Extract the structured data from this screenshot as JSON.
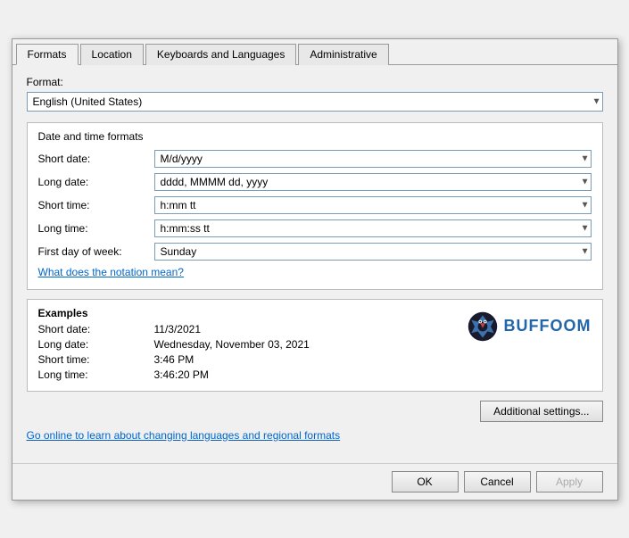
{
  "tabs": [
    {
      "label": "Formats",
      "active": true
    },
    {
      "label": "Location",
      "active": false
    },
    {
      "label": "Keyboards and Languages",
      "active": false
    },
    {
      "label": "Administrative",
      "active": false
    }
  ],
  "format_section": {
    "label": "Format:",
    "selected": "English (United States)"
  },
  "date_time_group": {
    "title": "Date and time formats",
    "rows": [
      {
        "label": "Short date:",
        "value": "M/d/yyyy"
      },
      {
        "label": "Long date:",
        "value": "dddd, MMMM dd, yyyy"
      },
      {
        "label": "Short time:",
        "value": "h:mm tt"
      },
      {
        "label": "Long time:",
        "value": "h:mm:ss tt"
      },
      {
        "label": "First day of week:",
        "value": "Sunday"
      }
    ]
  },
  "notation_link": "What does the notation mean?",
  "examples": {
    "title": "Examples",
    "rows": [
      {
        "label": "Short date:",
        "value": "11/3/2021"
      },
      {
        "label": "Long date:",
        "value": "Wednesday, November 03, 2021"
      },
      {
        "label": "Short time:",
        "value": "3:46 PM"
      },
      {
        "label": "Long time:",
        "value": "3:46:20 PM"
      }
    ]
  },
  "additional_btn": "Additional settings...",
  "online_link": "Go online to learn about changing languages and regional formats",
  "buttons": {
    "ok": "OK",
    "cancel": "Cancel",
    "apply": "Apply"
  }
}
